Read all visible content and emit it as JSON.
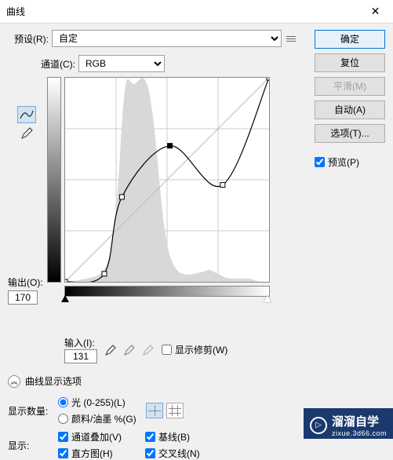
{
  "title": "曲线",
  "preset": {
    "label": "预设(R):",
    "value": "自定"
  },
  "channel": {
    "label": "通道(C):",
    "value": "RGB"
  },
  "output": {
    "label": "输出(O):",
    "value": "170"
  },
  "input": {
    "label": "输入(I):",
    "value": "131"
  },
  "show_clipping": "显示修剪(W)",
  "disclosure": "曲线显示选项",
  "amount": {
    "label": "显示数量:",
    "opt_light": "光 (0-255)(L)",
    "opt_pigment": "颜料/油墨 %(G)"
  },
  "show": {
    "label": "显示:",
    "overlay": "通道叠加(V)",
    "baseline": "基线(B)",
    "histogram": "直方图(H)",
    "intersection": "交叉线(N)"
  },
  "buttons": {
    "ok": "确定",
    "reset": "复位",
    "smooth": "平滑(M)",
    "auto": "自动(A)",
    "options": "选项(T)..."
  },
  "preview": "预览(P)",
  "watermark": {
    "main": "溜溜自学",
    "sub": "zixue.3d66.com"
  },
  "chart_data": {
    "type": "curve",
    "xlabel": "输入",
    "ylabel": "输出",
    "xlim": [
      0,
      255
    ],
    "ylim": [
      0,
      255
    ],
    "points": [
      {
        "in": 0,
        "out": 0
      },
      {
        "in": 49,
        "out": 10
      },
      {
        "in": 71,
        "out": 106
      },
      {
        "in": 131,
        "out": 170,
        "selected": true
      },
      {
        "in": 197,
        "out": 121
      },
      {
        "in": 255,
        "out": 255
      }
    ],
    "histogram": [
      0,
      0,
      0,
      0,
      1,
      1,
      1,
      2,
      2,
      2,
      3,
      3,
      3,
      4,
      4,
      5,
      5,
      6,
      6,
      7,
      8,
      9,
      10,
      12,
      15,
      18,
      22,
      28,
      35,
      45,
      58,
      75,
      95,
      120,
      150,
      185,
      215,
      235,
      248,
      252,
      250,
      248,
      246,
      245,
      246,
      248,
      250,
      252,
      253,
      252,
      250,
      245,
      238,
      228,
      215,
      200,
      182,
      162,
      140,
      118,
      98,
      80,
      65,
      52,
      42,
      34,
      28,
      23,
      19,
      16,
      14,
      12,
      11,
      10,
      10,
      9,
      9,
      9,
      9,
      9,
      10,
      10,
      11,
      11,
      12,
      12,
      13,
      13,
      14,
      15,
      15,
      14,
      13,
      12,
      11,
      10,
      9,
      8,
      7,
      6,
      5,
      5,
      4,
      4,
      4,
      4,
      4,
      4,
      4,
      4,
      4,
      4,
      4,
      4,
      4,
      4,
      3,
      3,
      2,
      1,
      1,
      0,
      0,
      0,
      0,
      0,
      0,
      0
    ]
  }
}
